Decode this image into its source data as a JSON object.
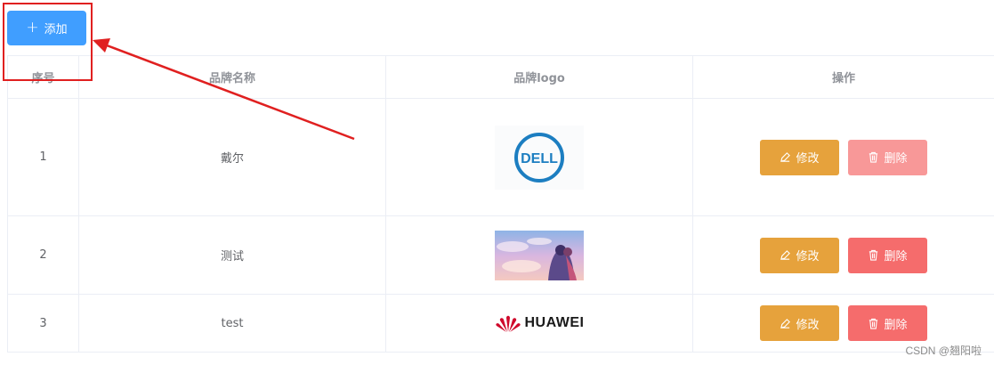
{
  "toolbar": {
    "add_label": "添加",
    "add_icon": "plus-icon"
  },
  "table": {
    "headers": [
      "序号",
      "品牌名称",
      "品牌logo",
      "操作"
    ],
    "rows": [
      {
        "index": "1",
        "name": "戴尔",
        "logo": "dell-logo"
      },
      {
        "index": "2",
        "name": "测试",
        "logo": "anime-illustration"
      },
      {
        "index": "3",
        "name": "test",
        "logo": "huawei-logo"
      }
    ],
    "edit_label": "修改",
    "delete_label": "删除"
  },
  "logos": {
    "dell_text": "DELL",
    "huawei_text": "HUAWEI"
  },
  "watermark": "CSDN @翘阳啦",
  "colors": {
    "primary": "#409eff",
    "warning": "#e6a23c",
    "danger": "#f56c6c",
    "annotation": "#e02020"
  }
}
